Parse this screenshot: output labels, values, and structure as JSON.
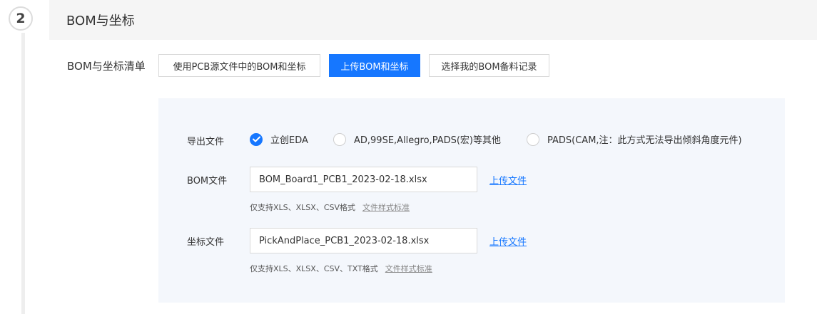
{
  "step": {
    "number": "2",
    "title": "BOM与坐标"
  },
  "source": {
    "label": "BOM与坐标清单",
    "buttons": [
      "使用PCB源文件中的BOM和坐标",
      "上传BOM和坐标",
      "选择我的BOM备料记录"
    ],
    "active_index": 1
  },
  "export": {
    "label": "导出文件",
    "options": [
      "立创EDA",
      "AD,99SE,Allegro,PADS(宏)等其他",
      "PADS(CAM,注：此方式无法导出倾斜角度元件)"
    ],
    "selected_index": 0
  },
  "bom_file": {
    "label": "BOM文件",
    "value": "BOM_Board1_PCB1_2023-02-18.xlsx",
    "upload_label": "上传文件",
    "hint": "仅支持XLS、XLSX、CSV格式",
    "standard_link": "文件样式标准"
  },
  "coord_file": {
    "label": "坐标文件",
    "value": "PickAndPlace_PCB1_2023-02-18.xlsx",
    "upload_label": "上传文件",
    "hint": "仅支持XLS、XLSX、CSV、TXT格式",
    "standard_link": "文件样式标准"
  },
  "colors": {
    "primary": "#1677ff",
    "panel_bg": "#f4f7fc",
    "header_bg": "#f5f5f5"
  },
  "icons": {
    "checked_radio": "checkmark-icon"
  }
}
